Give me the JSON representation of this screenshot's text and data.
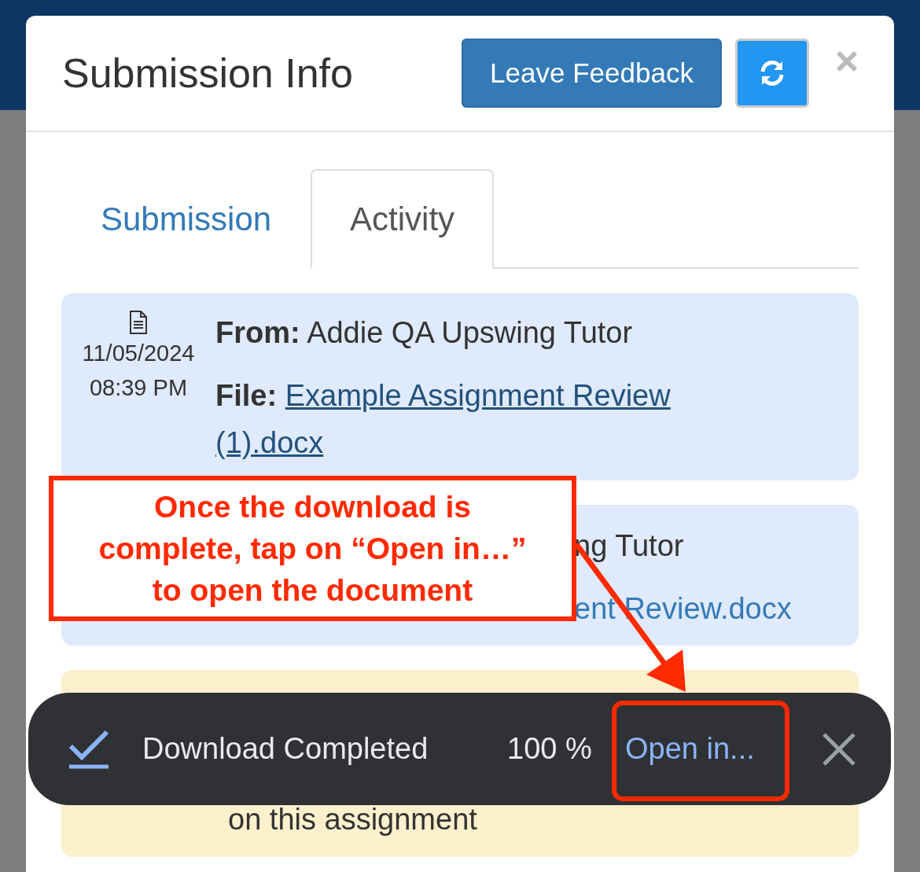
{
  "header": {
    "title": "Submission Info",
    "feedback_button": "Leave Feedback"
  },
  "tabs": [
    {
      "label": "Submission",
      "selected": false
    },
    {
      "label": "Activity",
      "selected": true
    }
  ],
  "activities": [
    {
      "kind": "file",
      "date": "11/05/2024",
      "time": "08:39 PM",
      "from_label": "From:",
      "from": "Addie QA Upswing Tutor",
      "file_label": "File:",
      "file": "Example Assignment Review (1).docx"
    },
    {
      "kind": "partial",
      "from": "ng Tutor",
      "file": "ent Review.docx"
    },
    {
      "kind": "note",
      "text": "on this assignment"
    }
  ],
  "annotation": {
    "lines": [
      "Once the download is",
      "complete, tap on “Open in…”",
      "to open the document"
    ]
  },
  "toast": {
    "status": "Download Completed",
    "percent": "100 %",
    "action": "Open in..."
  }
}
